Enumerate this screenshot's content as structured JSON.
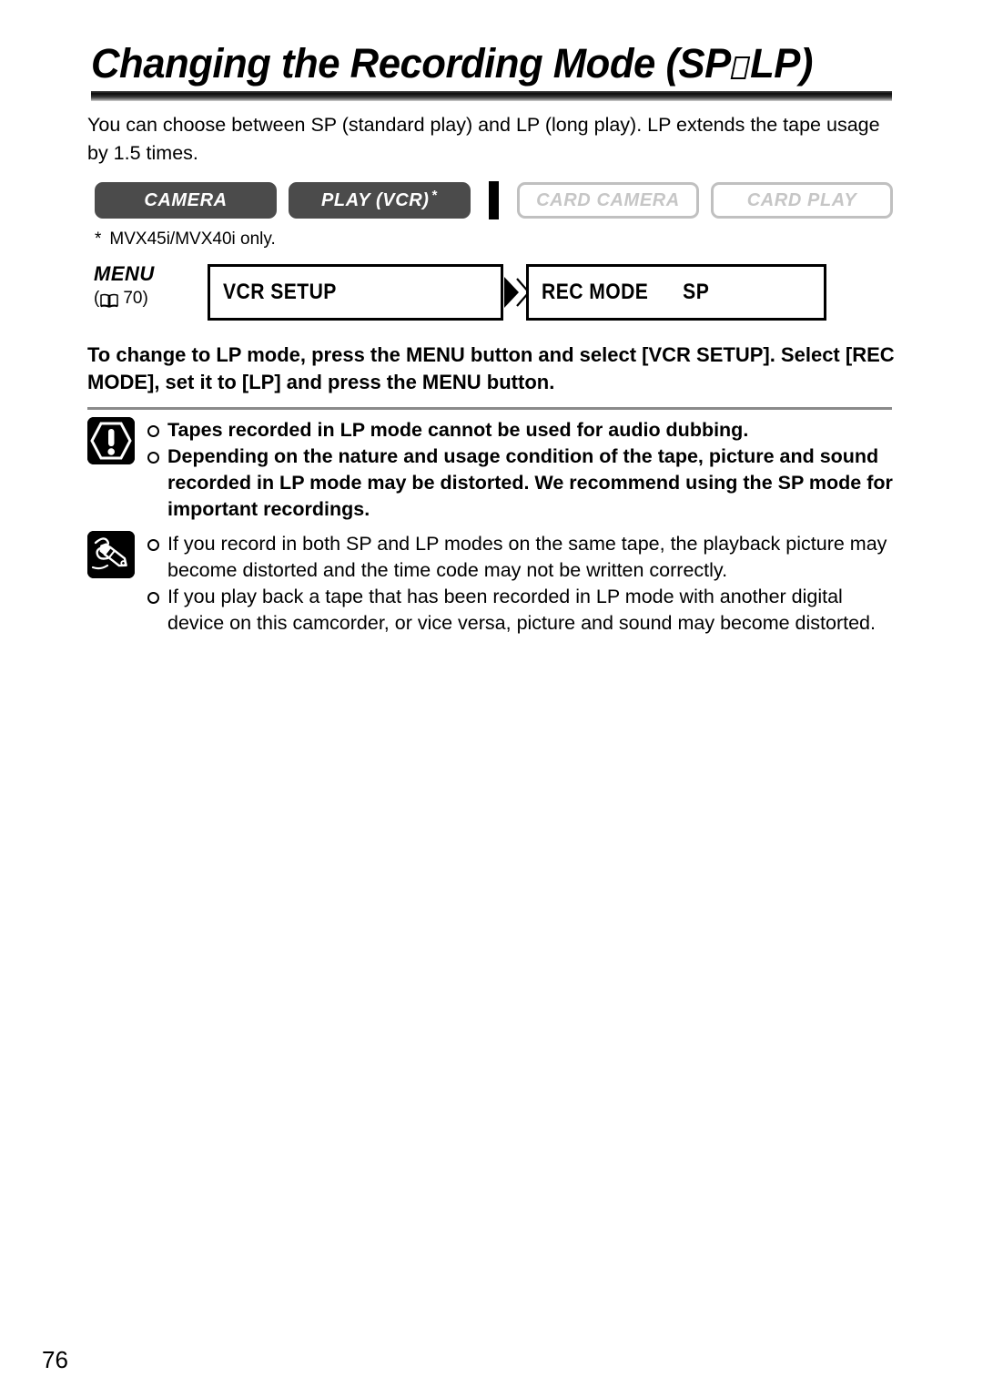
{
  "document": {
    "title_prefix": "Changing the Recording Mode (SP",
    "title_suffix": "LP)",
    "title_full": "Changing the Recording Mode (SP□LP)",
    "page_number": "76"
  },
  "intro": {
    "text": "You can choose between SP (standard play) and LP (long play). LP extends the tape usage by 1.5 times."
  },
  "modes": {
    "camera": {
      "label": "CAMERA",
      "state": "enabled"
    },
    "play_vcr": {
      "label": "PLAY (VCR)",
      "star": "*",
      "state": "enabled"
    },
    "card_camera": {
      "label": "CARD CAMERA",
      "state": "disabled"
    },
    "card_play": {
      "label": "CARD PLAY",
      "state": "disabled"
    },
    "divider": "vertical-bar"
  },
  "footnote": {
    "star": "*",
    "text": "MVX45i/MVX40i only."
  },
  "menu": {
    "label": "MENU",
    "ref_open": "(",
    "ref_page": "70",
    "ref_close": ")",
    "box1": "VCR SETUP",
    "box2_name": "REC MODE",
    "box2_value": "SP",
    "box2_text": "REC MODE      SP"
  },
  "instruction": {
    "line1": "To change to LP mode, press the MENU button and select [VCR SETUP].",
    "line2": "Select  [REC MODE], set it to [LP] and press the MENU button.",
    "text": "To change to LP mode, press the MENU button and select [VCR SETUP]. Select  [REC MODE], set it to [LP] and press the MENU button."
  },
  "warning": {
    "icon": "warning-exclamation-icon",
    "bullets": [
      "Tapes recorded in LP mode cannot be used for audio dubbing.",
      "Depending on the nature and usage condition of the tape, picture and sound recorded in LP mode may be distorted. We recommend using the SP mode for important recordings."
    ]
  },
  "note": {
    "icon": "note-pencil-icon",
    "bullets": [
      "If you record in both SP and LP modes on the same tape, the playback picture may become distorted and the time code may not be written correctly.",
      "If you play back a tape that has been recorded in LP mode with another digital device on this camcorder, or vice versa, picture and sound may become distorted."
    ]
  },
  "colors": {
    "mode_on_bg": "#4b4b4b",
    "mode_off_border": "#c0c0c0",
    "mode_off_text": "#c6c6c6",
    "rule_gray": "#8a8a8a",
    "ink": "#000000"
  }
}
